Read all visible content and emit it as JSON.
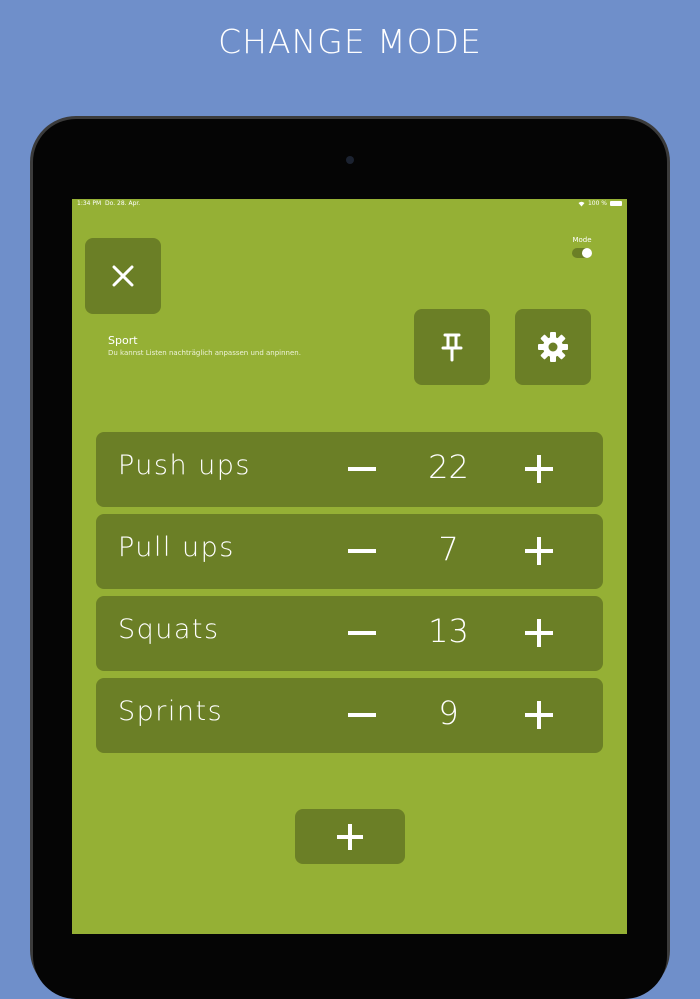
{
  "headline": "CHANGE MODE",
  "status_bar": {
    "time": "1:34 PM",
    "date": "Do. 28. Apr.",
    "battery": "100 %"
  },
  "mode": {
    "label": "Mode",
    "enabled": true
  },
  "list": {
    "title": "Sport",
    "subtitle": "Du kannst Listen nachträglich anpassen und anpinnen."
  },
  "counters": [
    {
      "name": "Push ups",
      "count": "22"
    },
    {
      "name": "Pull ups",
      "count": "7"
    },
    {
      "name": "Squats",
      "count": "13"
    },
    {
      "name": "Sprints",
      "count": "9"
    }
  ],
  "icons": {
    "close": "close-icon",
    "pin": "pin-icon",
    "settings": "gear-icon",
    "add": "plus-icon",
    "decrement": "minus-icon",
    "increment": "plus-icon"
  },
  "colors": {
    "background": "#6f8fca",
    "screen": "#95b035",
    "tile": "#6b7f26",
    "text": "#ffffff"
  }
}
